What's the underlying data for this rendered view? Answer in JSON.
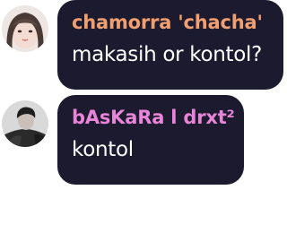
{
  "messages": [
    {
      "author": "chamorra 'chacha'",
      "author_color": "#f0a070",
      "text": "makasih or kontol?",
      "avatar": "profile-photo-girl"
    },
    {
      "author": "bAsKaRa l drxt²",
      "author_color": "#e985d8",
      "text": "kontol",
      "avatar": "profile-photo-man"
    }
  ],
  "colors": {
    "bubble": "#1b1a2e",
    "message_text": "#ffffff",
    "background": "#ffffff"
  }
}
